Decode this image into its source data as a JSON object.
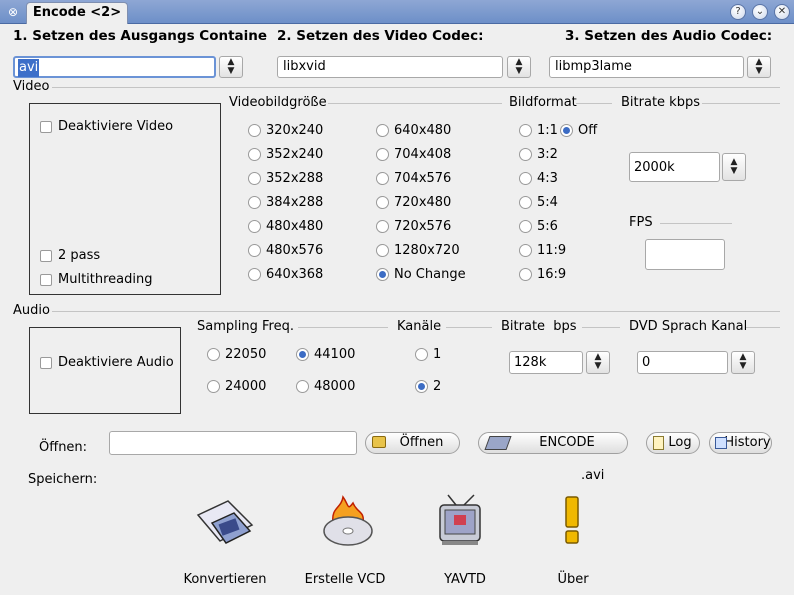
{
  "window": {
    "title": "Encode <2>"
  },
  "steps": {
    "container": "1. Setzen des Ausgangs Containe",
    "video_codec": "2. Setzen des Video Codec:",
    "audio_codec": "3. Setzen des Audio Codec:"
  },
  "combos": {
    "container": "avi",
    "video_codec": "libxvid",
    "audio_codec": "libmp3lame"
  },
  "video": {
    "group_label": "Video",
    "disable_label": "Deaktiviere Video",
    "twopass_label": "2 pass",
    "multithread_label": "Multithreading",
    "size_label": "Videobildgröße",
    "sizes_col1": [
      "320x240",
      "352x240",
      "352x288",
      "384x288",
      "480x480",
      "480x576",
      "640x368"
    ],
    "sizes_col2": [
      "640x480",
      "704x408",
      "704x576",
      "720x480",
      "720x576",
      "1280x720",
      "No Change"
    ],
    "selected_size": "No Change",
    "aspect_label": "Bildformat",
    "aspects": [
      "1:1",
      "3:2",
      "4:3",
      "5:4",
      "5:6",
      "11:9",
      "16:9"
    ],
    "aspect_off": "Off",
    "selected_aspect": "Off",
    "bitrate_label": "Bitrate kbps",
    "bitrate_value": "2000k",
    "fps_label": "FPS",
    "fps_value": ""
  },
  "audio": {
    "group_label": "Audio",
    "disable_label": "Deaktiviere Audio",
    "sampling_label": "Sampling Freq.",
    "freqs": [
      "22050",
      "44100",
      "24000",
      "48000"
    ],
    "selected_freq": "44100",
    "channels_label": "Kanäle",
    "channels": [
      "1",
      "2"
    ],
    "selected_channel": "2",
    "bitrate_label": "Bitrate  bps",
    "bitrate_value": "128k",
    "dvd_label": "DVD Sprach Kanal",
    "dvd_value": "0"
  },
  "file": {
    "open_label": "Öffnen:",
    "open_value": "",
    "open_button": "Öffnen",
    "encode_button": "ENCODE",
    "log_button": "Log",
    "history_button": "History",
    "save_label": "Speichern:",
    "extension": ".avi"
  },
  "tools": {
    "convert": "Konvertieren",
    "vcd": "Erstelle VCD",
    "yavtd": "YAVTD",
    "about": "Über"
  },
  "icons": {
    "sysmenu": "window-menu-icon",
    "help": "help-icon",
    "minimize": "minimize-icon",
    "close": "close-icon"
  }
}
